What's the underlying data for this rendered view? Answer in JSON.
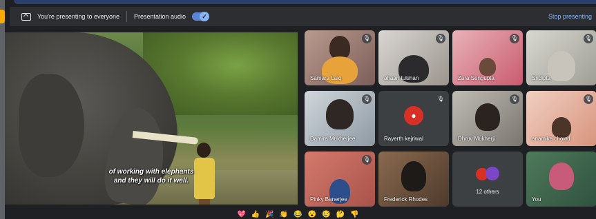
{
  "presenting_bar": {
    "message": "You're presenting to everyone",
    "audio_label": "Presentation audio",
    "audio_enabled": true,
    "stop_label": "Stop presenting"
  },
  "shared_screen": {
    "caption_line1": "of working with elephants",
    "caption_line2": "and they will do it well."
  },
  "participants": [
    {
      "name": "Samara Laiq",
      "muted": true
    },
    {
      "name": "ahaan tulshan",
      "muted": true
    },
    {
      "name": "Zara Sengupta",
      "muted": true
    },
    {
      "name": "Sridipta",
      "muted": true
    },
    {
      "name": "Damira Mukherjee",
      "muted": true
    },
    {
      "name": "Rayerth kejriwal",
      "muted": true
    },
    {
      "name": "Dhruv Mukherji",
      "muted": true
    },
    {
      "name": "anamika chowd",
      "muted": true
    },
    {
      "name": "Pinky Banerjee",
      "muted": true
    },
    {
      "name": "Frederick Rhodes",
      "muted": true
    },
    {
      "name": "12 others",
      "muted": false
    },
    {
      "name": "You",
      "muted": false
    }
  ],
  "reactions": [
    "💖",
    "👍",
    "🎉",
    "👏",
    "😂",
    "😮",
    "😢",
    "🤔",
    "👎"
  ],
  "colors": {
    "accent": "#8ab4f8",
    "background": "#202124",
    "tile": "#3c4043",
    "presenting_indicator": "#f9ab00"
  }
}
